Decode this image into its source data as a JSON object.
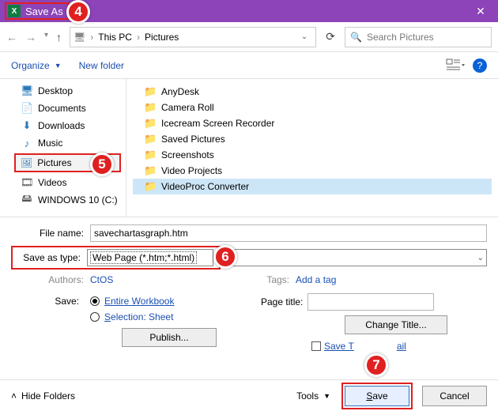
{
  "title": "Save As",
  "breadcrumb": {
    "root": "This PC",
    "current": "Pictures"
  },
  "search_placeholder": "Search Pictures",
  "toolbar": {
    "organize": "Organize",
    "newfolder": "New folder"
  },
  "tree": {
    "desktop": "Desktop",
    "documents": "Documents",
    "downloads": "Downloads",
    "music": "Music",
    "pictures": "Pictures",
    "videos": "Videos",
    "drive": "WINDOWS 10 (C:)"
  },
  "folders": [
    "AnyDesk",
    "Camera Roll",
    "Icecream Screen Recorder",
    "Saved Pictures",
    "Screenshots",
    "Video Projects",
    "VideoProc Converter"
  ],
  "form": {
    "filename_label": "File name:",
    "filename_value": "savechartasgraph.htm",
    "type_label": "Save as type:",
    "type_value": "Web Page (*.htm;*.html)",
    "authors_label": "Authors:",
    "authors_value": "CtOS",
    "tags_label": "Tags:",
    "tags_value": "Add a tag",
    "save_label": "Save:",
    "radio1": "Entire Workbook",
    "radio2": "Selection: Sheet",
    "publish": "Publish...",
    "page_title_label": "Page title:",
    "change_title": "Change Title...",
    "thumbnail_left": "Save T",
    "thumbnail_right": "ail"
  },
  "bottom": {
    "hide": "Hide Folders",
    "tools": "Tools",
    "save": "Save",
    "cancel": "Cancel"
  },
  "callouts": {
    "c4": "4",
    "c5": "5",
    "c6": "6",
    "c7": "7"
  }
}
